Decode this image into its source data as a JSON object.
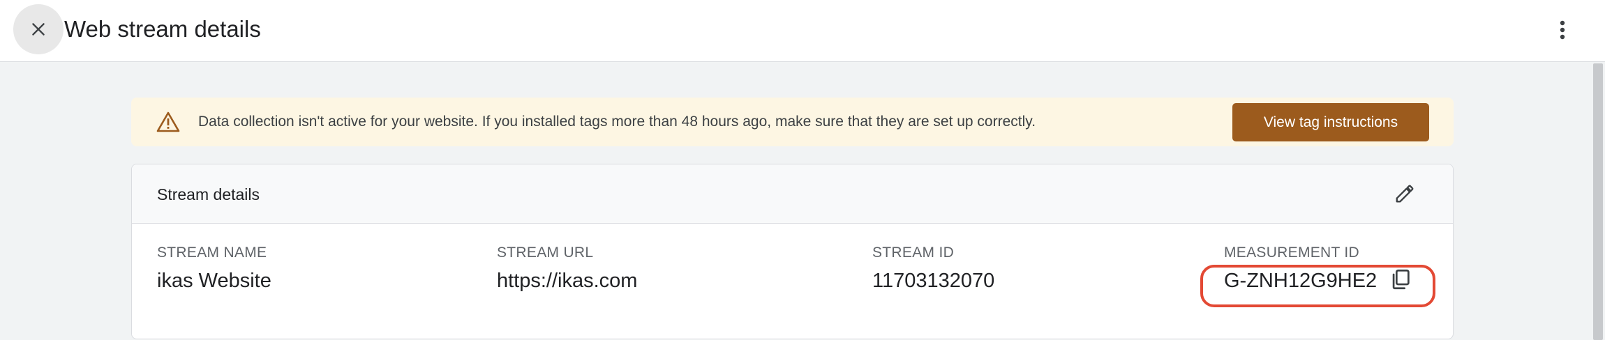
{
  "header": {
    "title": "Web stream details",
    "close_icon": "close-icon",
    "more_icon": "more-vert-icon"
  },
  "banner": {
    "icon": "warning-icon",
    "message": "Data collection isn't active for your website. If you installed tags more than 48 hours ago, make sure that they are set up correctly.",
    "button_label": "View tag instructions",
    "background_color": "#fdf6e3",
    "button_color": "#9c5b1d"
  },
  "stream_details": {
    "title": "Stream details",
    "edit_icon": "edit-pencil-icon",
    "fields": [
      {
        "label": "STREAM NAME",
        "value": "ikas Website"
      },
      {
        "label": "STREAM URL",
        "value": "https://ikas.com"
      },
      {
        "label": "STREAM ID",
        "value": "11703132070"
      },
      {
        "label": "MEASUREMENT ID",
        "value": "G-ZNH12G9HE2"
      }
    ],
    "copy_icon": "copy-icon"
  },
  "annotation": {
    "highlight_color": "#e34934"
  }
}
